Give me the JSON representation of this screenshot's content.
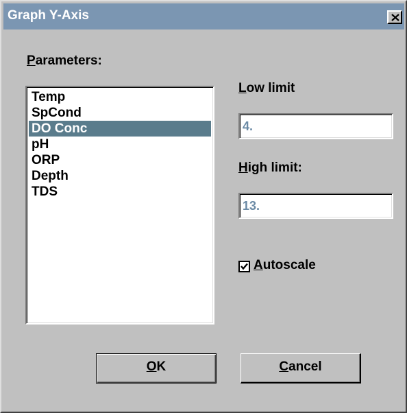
{
  "window": {
    "title": "Graph Y-Axis"
  },
  "parameters": {
    "label_accel": "P",
    "label_rest": "arameters:",
    "items": [
      "Temp",
      "SpCond",
      "DO Conc",
      "pH",
      "ORP",
      "Depth",
      "TDS"
    ],
    "selected": "DO Conc"
  },
  "low_limit": {
    "label_accel": "L",
    "label_rest": "ow limit",
    "value": "4."
  },
  "high_limit": {
    "label_accel": "H",
    "label_rest": "igh limit:",
    "value": "13."
  },
  "autoscale": {
    "label_accel": "A",
    "label_rest": "utoscale",
    "checked": true
  },
  "buttons": {
    "ok_accel": "O",
    "ok_rest": "K",
    "cancel_accel": "C",
    "cancel_rest": "ancel"
  },
  "colors": {
    "titlebar": "#7b96b2",
    "selection": "#5a7c8c",
    "field_text": "#6b8aa5",
    "face": "#c0c0c0"
  },
  "icons": {
    "close": "close-icon",
    "check": "checkmark-icon"
  }
}
